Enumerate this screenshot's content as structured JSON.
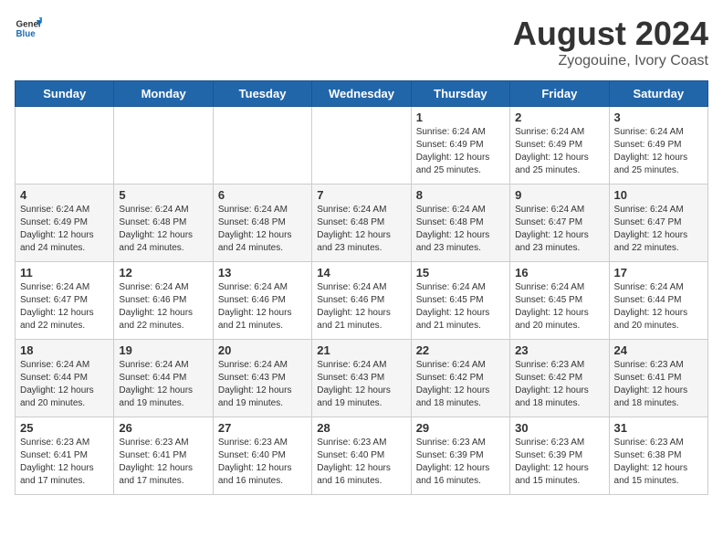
{
  "header": {
    "logo_general": "General",
    "logo_blue": "Blue",
    "month_year": "August 2024",
    "location": "Zyogouine, Ivory Coast"
  },
  "weekdays": [
    "Sunday",
    "Monday",
    "Tuesday",
    "Wednesday",
    "Thursday",
    "Friday",
    "Saturday"
  ],
  "weeks": [
    [
      {
        "day": "",
        "detail": ""
      },
      {
        "day": "",
        "detail": ""
      },
      {
        "day": "",
        "detail": ""
      },
      {
        "day": "",
        "detail": ""
      },
      {
        "day": "1",
        "detail": "Sunrise: 6:24 AM\nSunset: 6:49 PM\nDaylight: 12 hours\nand 25 minutes."
      },
      {
        "day": "2",
        "detail": "Sunrise: 6:24 AM\nSunset: 6:49 PM\nDaylight: 12 hours\nand 25 minutes."
      },
      {
        "day": "3",
        "detail": "Sunrise: 6:24 AM\nSunset: 6:49 PM\nDaylight: 12 hours\nand 25 minutes."
      }
    ],
    [
      {
        "day": "4",
        "detail": "Sunrise: 6:24 AM\nSunset: 6:49 PM\nDaylight: 12 hours\nand 24 minutes."
      },
      {
        "day": "5",
        "detail": "Sunrise: 6:24 AM\nSunset: 6:48 PM\nDaylight: 12 hours\nand 24 minutes."
      },
      {
        "day": "6",
        "detail": "Sunrise: 6:24 AM\nSunset: 6:48 PM\nDaylight: 12 hours\nand 24 minutes."
      },
      {
        "day": "7",
        "detail": "Sunrise: 6:24 AM\nSunset: 6:48 PM\nDaylight: 12 hours\nand 23 minutes."
      },
      {
        "day": "8",
        "detail": "Sunrise: 6:24 AM\nSunset: 6:48 PM\nDaylight: 12 hours\nand 23 minutes."
      },
      {
        "day": "9",
        "detail": "Sunrise: 6:24 AM\nSunset: 6:47 PM\nDaylight: 12 hours\nand 23 minutes."
      },
      {
        "day": "10",
        "detail": "Sunrise: 6:24 AM\nSunset: 6:47 PM\nDaylight: 12 hours\nand 22 minutes."
      }
    ],
    [
      {
        "day": "11",
        "detail": "Sunrise: 6:24 AM\nSunset: 6:47 PM\nDaylight: 12 hours\nand 22 minutes."
      },
      {
        "day": "12",
        "detail": "Sunrise: 6:24 AM\nSunset: 6:46 PM\nDaylight: 12 hours\nand 22 minutes."
      },
      {
        "day": "13",
        "detail": "Sunrise: 6:24 AM\nSunset: 6:46 PM\nDaylight: 12 hours\nand 21 minutes."
      },
      {
        "day": "14",
        "detail": "Sunrise: 6:24 AM\nSunset: 6:46 PM\nDaylight: 12 hours\nand 21 minutes."
      },
      {
        "day": "15",
        "detail": "Sunrise: 6:24 AM\nSunset: 6:45 PM\nDaylight: 12 hours\nand 21 minutes."
      },
      {
        "day": "16",
        "detail": "Sunrise: 6:24 AM\nSunset: 6:45 PM\nDaylight: 12 hours\nand 20 minutes."
      },
      {
        "day": "17",
        "detail": "Sunrise: 6:24 AM\nSunset: 6:44 PM\nDaylight: 12 hours\nand 20 minutes."
      }
    ],
    [
      {
        "day": "18",
        "detail": "Sunrise: 6:24 AM\nSunset: 6:44 PM\nDaylight: 12 hours\nand 20 minutes."
      },
      {
        "day": "19",
        "detail": "Sunrise: 6:24 AM\nSunset: 6:44 PM\nDaylight: 12 hours\nand 19 minutes."
      },
      {
        "day": "20",
        "detail": "Sunrise: 6:24 AM\nSunset: 6:43 PM\nDaylight: 12 hours\nand 19 minutes."
      },
      {
        "day": "21",
        "detail": "Sunrise: 6:24 AM\nSunset: 6:43 PM\nDaylight: 12 hours\nand 19 minutes."
      },
      {
        "day": "22",
        "detail": "Sunrise: 6:24 AM\nSunset: 6:42 PM\nDaylight: 12 hours\nand 18 minutes."
      },
      {
        "day": "23",
        "detail": "Sunrise: 6:23 AM\nSunset: 6:42 PM\nDaylight: 12 hours\nand 18 minutes."
      },
      {
        "day": "24",
        "detail": "Sunrise: 6:23 AM\nSunset: 6:41 PM\nDaylight: 12 hours\nand 18 minutes."
      }
    ],
    [
      {
        "day": "25",
        "detail": "Sunrise: 6:23 AM\nSunset: 6:41 PM\nDaylight: 12 hours\nand 17 minutes."
      },
      {
        "day": "26",
        "detail": "Sunrise: 6:23 AM\nSunset: 6:41 PM\nDaylight: 12 hours\nand 17 minutes."
      },
      {
        "day": "27",
        "detail": "Sunrise: 6:23 AM\nSunset: 6:40 PM\nDaylight: 12 hours\nand 16 minutes."
      },
      {
        "day": "28",
        "detail": "Sunrise: 6:23 AM\nSunset: 6:40 PM\nDaylight: 12 hours\nand 16 minutes."
      },
      {
        "day": "29",
        "detail": "Sunrise: 6:23 AM\nSunset: 6:39 PM\nDaylight: 12 hours\nand 16 minutes."
      },
      {
        "day": "30",
        "detail": "Sunrise: 6:23 AM\nSunset: 6:39 PM\nDaylight: 12 hours\nand 15 minutes."
      },
      {
        "day": "31",
        "detail": "Sunrise: 6:23 AM\nSunset: 6:38 PM\nDaylight: 12 hours\nand 15 minutes."
      }
    ]
  ]
}
